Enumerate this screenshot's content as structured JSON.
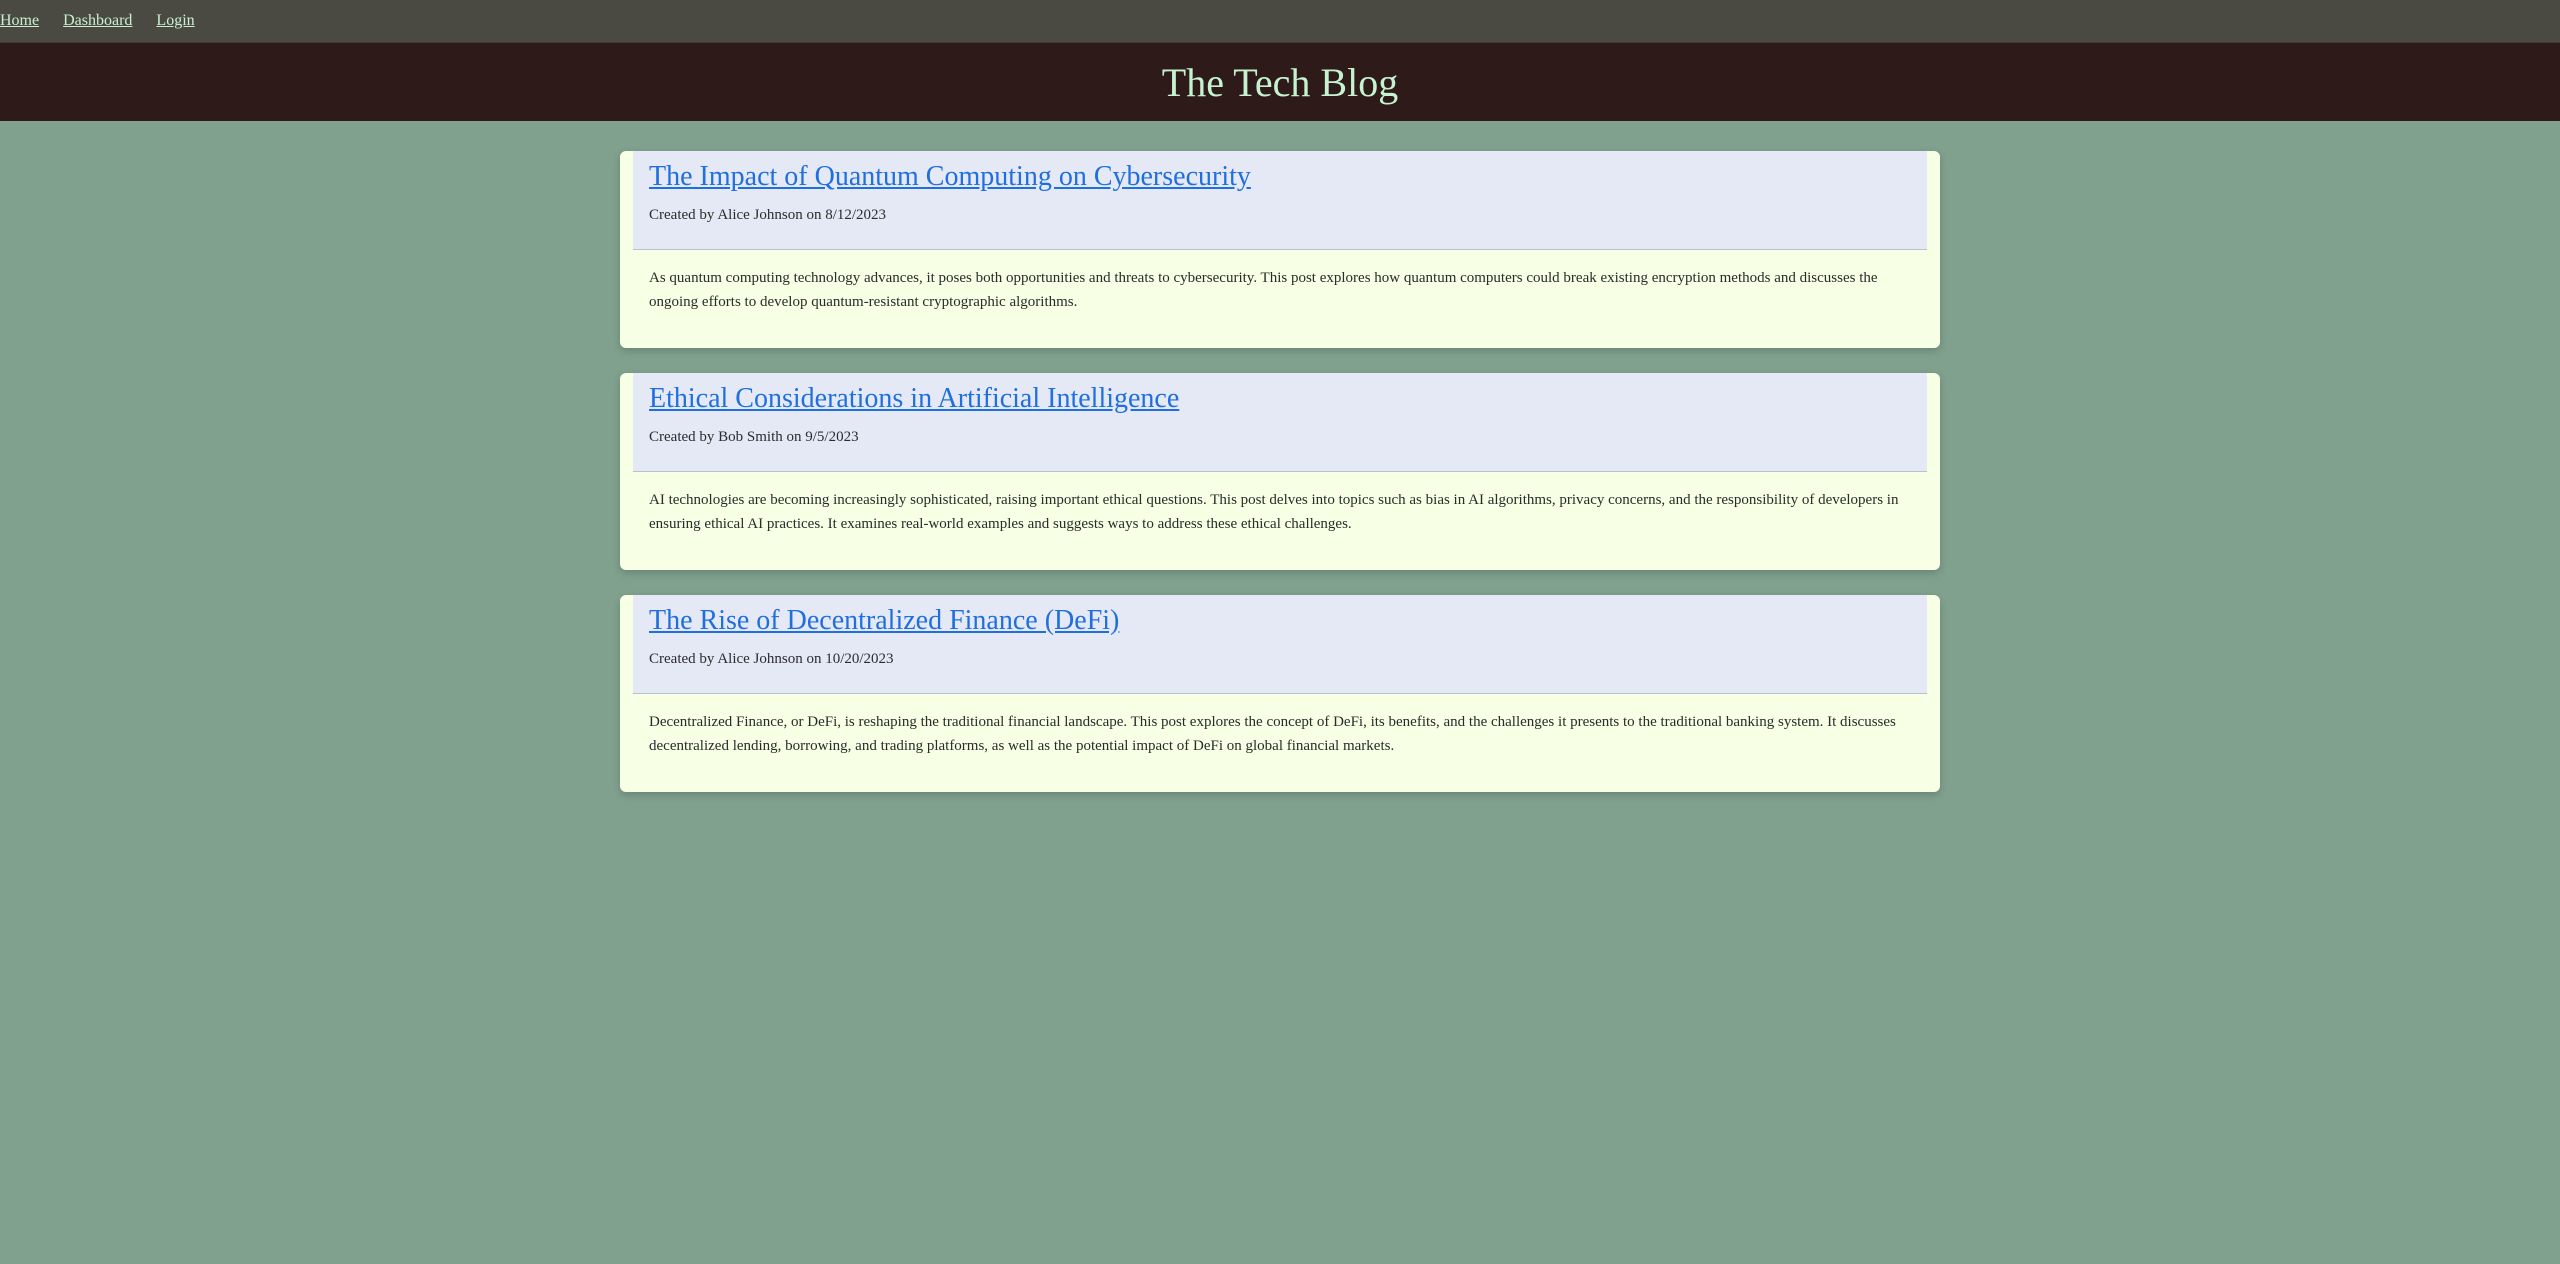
{
  "nav": {
    "items": [
      "Home",
      "Dashboard",
      "Login"
    ]
  },
  "header": {
    "title": "The Tech Blog"
  },
  "posts": [
    {
      "title": "The Impact of Quantum Computing on Cybersecurity",
      "meta": "Created by Alice Johnson on 8/12/2023",
      "body": "As quantum computing technology advances, it poses both opportunities and threats to cybersecurity. This post explores how quantum computers could break existing encryption methods and discusses the ongoing efforts to develop quantum-resistant cryptographic algorithms."
    },
    {
      "title": "Ethical Considerations in Artificial Intelligence",
      "meta": "Created by Bob Smith on 9/5/2023",
      "body": "AI technologies are becoming increasingly sophisticated, raising important ethical questions. This post delves into topics such as bias in AI algorithms, privacy concerns, and the responsibility of developers in ensuring ethical AI practices. It examines real-world examples and suggests ways to address these ethical challenges."
    },
    {
      "title": "The Rise of Decentralized Finance (DeFi)",
      "meta": "Created by Alice Johnson on 10/20/2023",
      "body": "Decentralized Finance, or DeFi, is reshaping the traditional financial landscape. This post explores the concept of DeFi, its benefits, and the challenges it presents to the traditional banking system. It discusses decentralized lending, borrowing, and trading platforms, as well as the potential impact of DeFi on global financial markets."
    }
  ],
  "colors": {
    "page_bg": "#80a18e",
    "nav_bg": "#4a4a42",
    "header_bg": "#2f1a1a",
    "title_color": "#c6f3cf",
    "card_bg": "#f7ffe4",
    "card_head_bg": "#e5e9f6",
    "link_color": "#1f6fe0"
  }
}
